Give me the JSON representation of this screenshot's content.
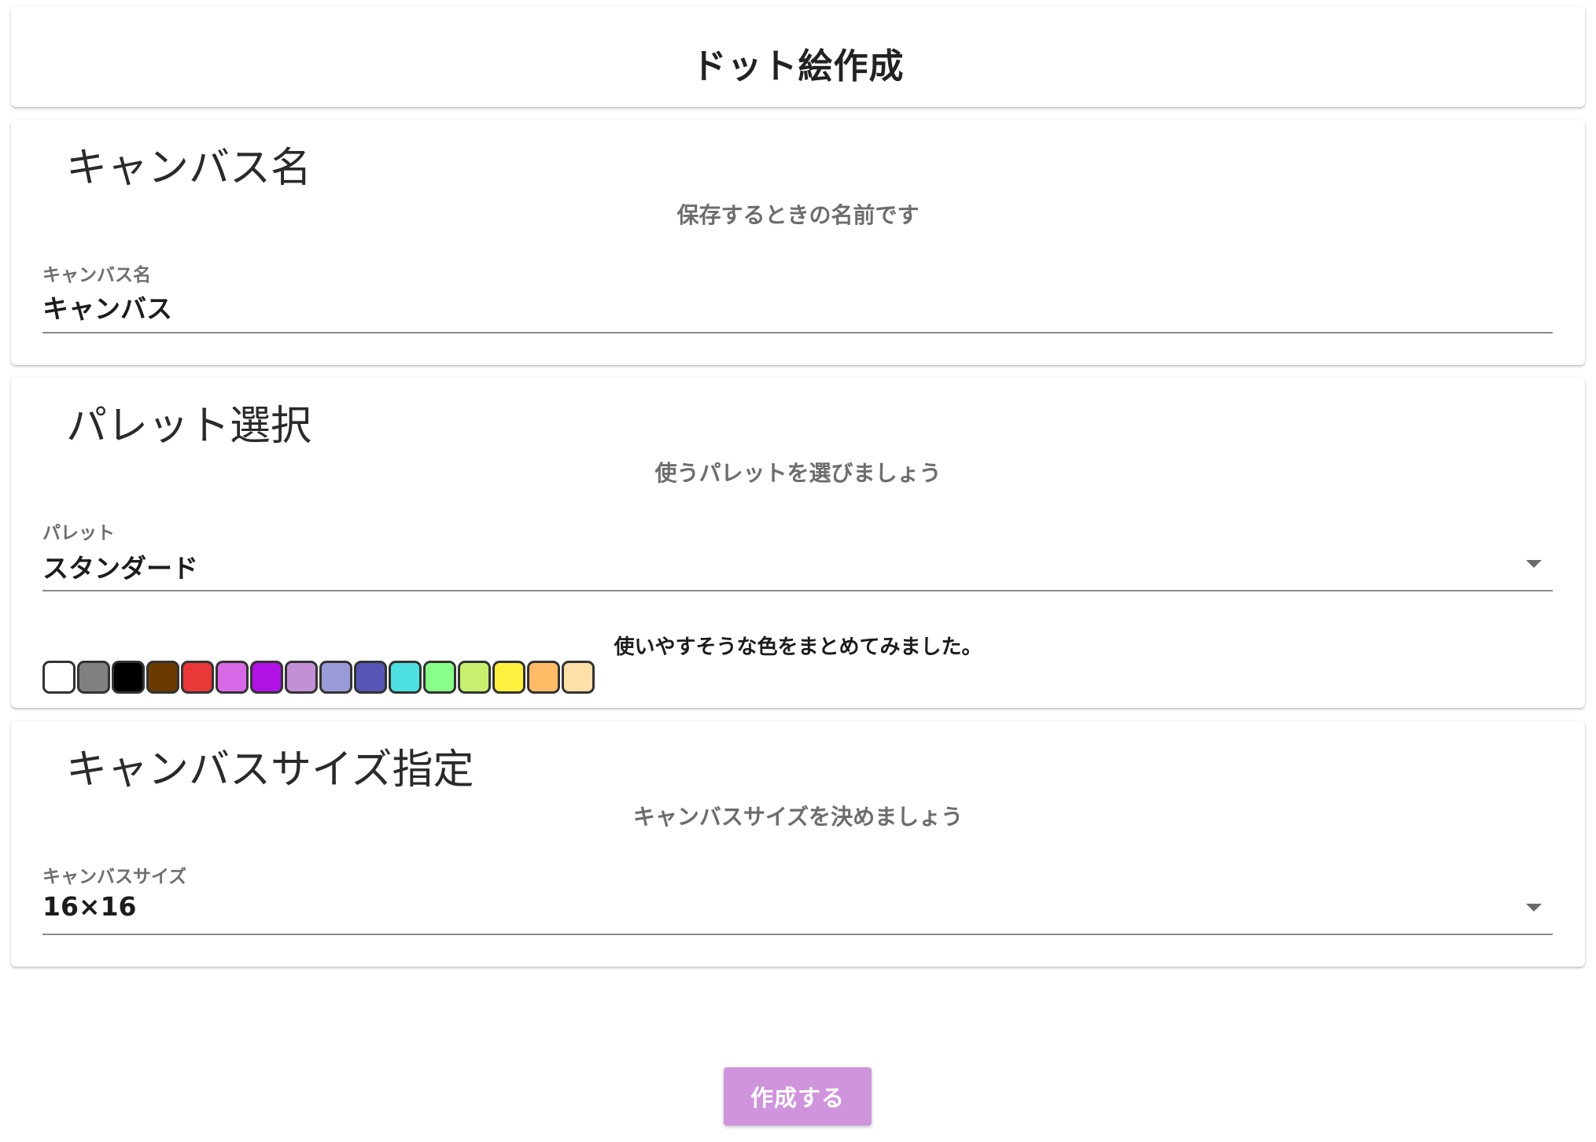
{
  "header": {
    "title": "ドット絵作成"
  },
  "canvas_name": {
    "title": "キャンバス名",
    "subtitle": "保存するときの名前です",
    "field_label": "キャンバス名",
    "field_value": "キャンバス"
  },
  "palette": {
    "title": "パレット選択",
    "subtitle": "使うパレットを選びましょう",
    "field_label": "パレット",
    "selected": "スタンダード",
    "description": "使いやすそうな色をまとめてみました。",
    "colors": [
      "#ffffff",
      "#808080",
      "#000000",
      "#6b3a00",
      "#e83838",
      "#d869e6",
      "#b012e6",
      "#c38fd6",
      "#9a9ad8",
      "#5656b4",
      "#4ee0e0",
      "#88ff88",
      "#c8f070",
      "#fff040",
      "#ffbb66",
      "#ffe0a8"
    ]
  },
  "canvas_size": {
    "title": "キャンバスサイズ指定",
    "subtitle": "キャンバスサイズを決めましょう",
    "field_label": "キャンバスサイズ",
    "selected": "16×16"
  },
  "actions": {
    "create_label": "作成する",
    "create_color": "#cf94dc"
  }
}
